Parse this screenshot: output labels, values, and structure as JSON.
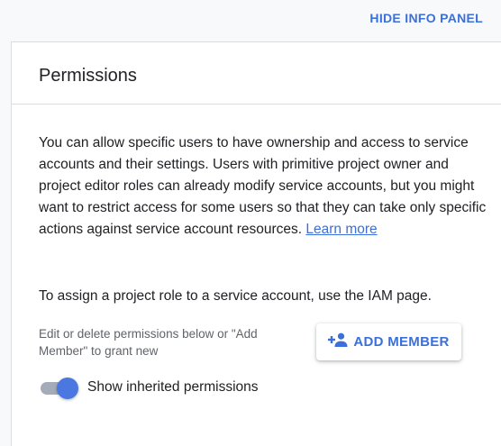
{
  "header": {
    "hide_panel_label": "HIDE INFO PANEL"
  },
  "panel": {
    "title": "Permissions",
    "description": "You can allow specific users to have ownership and access to service accounts and their settings. Users with primitive project owner and project editor roles can already modify service accounts, but you might want to restrict access for some users so that they can take only specific actions against service account resources.",
    "learn_more": "Learn more",
    "iam_note": "To assign a project role to a service account, use the IAM page.",
    "hint": "Edit or delete permissions below or \"Add Member\" to grant new",
    "add_member_label": "ADD MEMBER",
    "add_member_icon": "person-add-icon",
    "inherited_toggle": {
      "label": "Show inherited permissions",
      "checked": true
    }
  },
  "colors": {
    "accent": "#3b6fd9",
    "text": "#202124",
    "muted": "#5f6368"
  }
}
